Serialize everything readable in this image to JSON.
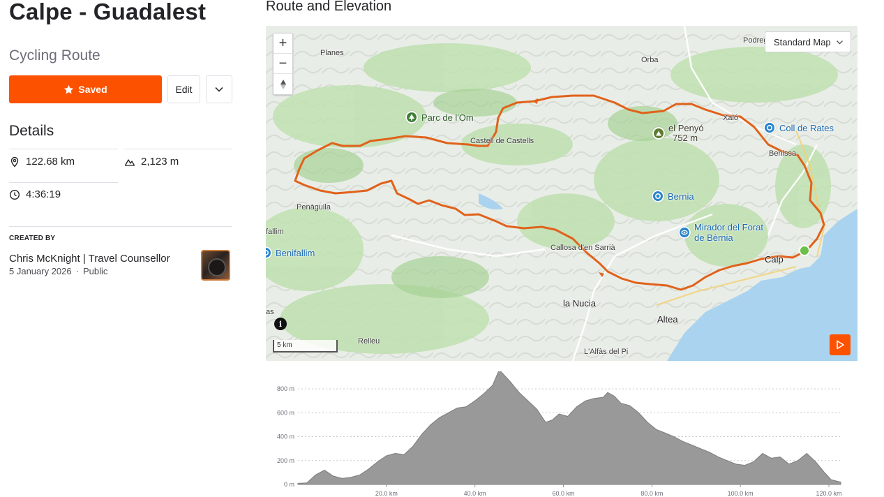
{
  "route": {
    "title": "Calpe - Guadalest",
    "subtitle": "Cycling Route"
  },
  "actions": {
    "saved_label": "Saved",
    "edit_label": "Edit",
    "more_icon": "chevron-down-icon",
    "saved_icon": "star-icon"
  },
  "details": {
    "heading": "Details",
    "distance": "122.68 km",
    "elevation_gain": "2,123 m",
    "moving_time": "4:36:19"
  },
  "creator": {
    "label": "CREATED BY",
    "name": "Chris McKnight | Travel Counsellor",
    "date": "5 January 2026",
    "separator": "·",
    "visibility": "Public"
  },
  "map": {
    "heading": "Route and Elevation",
    "style_selected": "Standard Map",
    "zoom_in": "+",
    "zoom_out": "−",
    "reset_bearing": "▲",
    "info": "i",
    "scale": "5 km",
    "places": {
      "planes": "Planes",
      "orba": "Orba",
      "podreg": "Podreg",
      "castell": "Castell de Castells",
      "xalo": "Xaló",
      "benissa": "Benissa",
      "penaguila": "Penàguila",
      "fallim": "fallim",
      "callosa": "Callosa d'en Sarrià",
      "calp": "Calp",
      "la_nucia": "la Nucia",
      "altea": "Altea",
      "relleu": "Relleu",
      "alfas": "L'Alfàs del Pi",
      "as": "as"
    },
    "pois": {
      "parc_om": "Parc de l'Om",
      "penyo_name": "el Penyó",
      "penyo_elev": "752 m",
      "coll_rates": "Coll de Rates",
      "bernia": "Bernia",
      "mirador_1": "Mirador del Forat",
      "mirador_2": "de Bèrnia",
      "benifallim": "Benifallim"
    },
    "colors": {
      "route": "#e0621b",
      "start": "#6cc04a",
      "sea": "#a9d3ef",
      "accent": "#fc5200"
    }
  },
  "chart_data": {
    "type": "area",
    "title": "",
    "xlabel": "",
    "ylabel": "",
    "xlim": [
      0,
      122.68
    ],
    "ylim": [
      0,
      900
    ],
    "y_ticks": [
      "0 m",
      "200 m",
      "400 m",
      "600 m",
      "800 m"
    ],
    "x_ticks": [
      "20.0 km",
      "40.0 km",
      "60.0 km",
      "80.0 km",
      "100.0 km",
      "120.0 km"
    ],
    "x": [
      0,
      2,
      4,
      6,
      8,
      10,
      12,
      14,
      16,
      18,
      20,
      22,
      24,
      26,
      28,
      30,
      32,
      34,
      36,
      38,
      40,
      42,
      44,
      45.5,
      48,
      50,
      52,
      54,
      56,
      57.5,
      59,
      61,
      63,
      65,
      67,
      69,
      70,
      71.5,
      73,
      75,
      77,
      79,
      81,
      83,
      85,
      87,
      89,
      91,
      93,
      95,
      97,
      99,
      101,
      103,
      105,
      107,
      109,
      111,
      113,
      115,
      117,
      119,
      120.5,
      122.68
    ],
    "y": [
      10,
      12,
      80,
      120,
      70,
      50,
      60,
      80,
      130,
      190,
      240,
      260,
      250,
      320,
      420,
      500,
      560,
      600,
      640,
      650,
      700,
      760,
      830,
      960,
      860,
      770,
      700,
      630,
      520,
      540,
      590,
      570,
      650,
      700,
      720,
      730,
      770,
      740,
      680,
      660,
      600,
      520,
      460,
      430,
      400,
      360,
      330,
      300,
      270,
      230,
      200,
      170,
      160,
      190,
      260,
      220,
      230,
      170,
      200,
      260,
      190,
      100,
      40,
      20
    ]
  }
}
